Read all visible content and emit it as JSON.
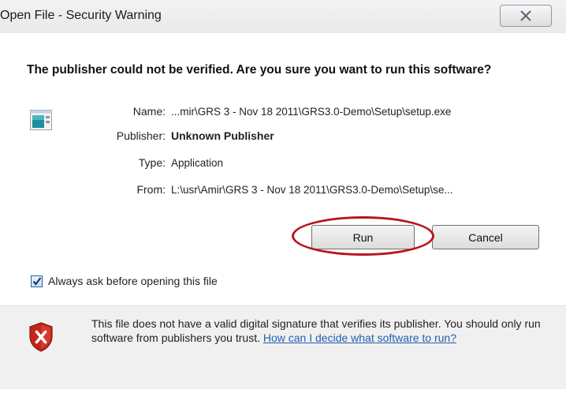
{
  "window": {
    "title": "Open File - Security Warning",
    "close_icon": "close-icon"
  },
  "dialog": {
    "question": "The publisher could not be verified.  Are you sure you want to run this software?",
    "app_icon": "application-icon",
    "fields": [
      {
        "label": "Name:",
        "value": "...mir\\GRS 3 - Nov 18 2011\\GRS3.0-Demo\\Setup\\setup.exe"
      },
      {
        "label": "Publisher:",
        "value": "Unknown Publisher"
      },
      {
        "label": "Type:",
        "value": "Application"
      },
      {
        "label": "From:",
        "value": "L:\\usr\\Amir\\GRS 3 - Nov 18 2011\\GRS3.0-Demo\\Setup\\se..."
      }
    ],
    "run_label": "Run",
    "cancel_label": "Cancel",
    "always_ask_label": "Always ask before opening this file",
    "always_ask_checked": true,
    "highlight_color": "#b8141e"
  },
  "footer": {
    "shield_icon": "shield-error-icon",
    "warning_text": "This file does not have a valid digital signature that verifies its publisher. You should only run software from publishers you trust.",
    "link_text": "How can I decide what software to run?"
  }
}
